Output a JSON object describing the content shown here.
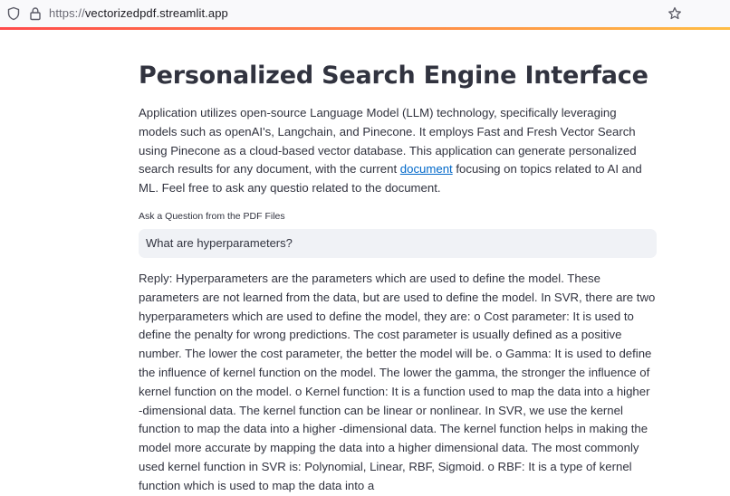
{
  "browser": {
    "url_scheme": "https://",
    "url_host": "vectorizedpdf.streamlit.app"
  },
  "page": {
    "title": "Personalized Search Engine Interface",
    "intro_before_link": "Application utilizes open-source Language Model (LLM) technology, specifically leveraging models such as openAI's, Langchain, and Pinecone. It employs Fast and Fresh Vector Search using Pinecone as a cloud-based vector database. This application can generate personalized search results for any document, with the current ",
    "intro_link": "document",
    "intro_after_link": " focusing on topics related to AI and ML. Feel free to ask any questio related to the document.",
    "question_label": "Ask a Question from the PDF Files",
    "question_value": "What are hyperparameters?",
    "reply": "Reply: Hyperparameters are the parameters which are used to define the model. These parameters are not learned from the data, but are used to define the model. In SVR, there are two hyperparameters which are used to define the model, they are: o Cost parameter: It is used to define the penalty for wrong predictions. The cost parameter is usually defined as a positive number. The lower the cost parameter, the better the model will be. o Gamma: It is used to define the influence of kernel function on the model. The lower the gamma, the stronger the influence of kernel function on the model. o Kernel function: It is a function used to map the data into a higher -dimensional data. The kernel function can be linear or nonlinear. In SVR, we use the kernel function to map the data into a higher -dimensional data. The kernel function helps in making the model more accurate by mapping the data into a higher dimensional data. The most commonly used kernel function in SVR is: Polynomial, Linear, RBF, Sigmoid. o RBF: It is a type of kernel function which is used to map the data into a"
  },
  "icons": {
    "shield": "shield-icon",
    "lock": "lock-icon",
    "bookmark": "star-icon"
  },
  "colors": {
    "link": "#0068c9",
    "input_bg": "#f0f2f6",
    "text": "#31333f"
  }
}
